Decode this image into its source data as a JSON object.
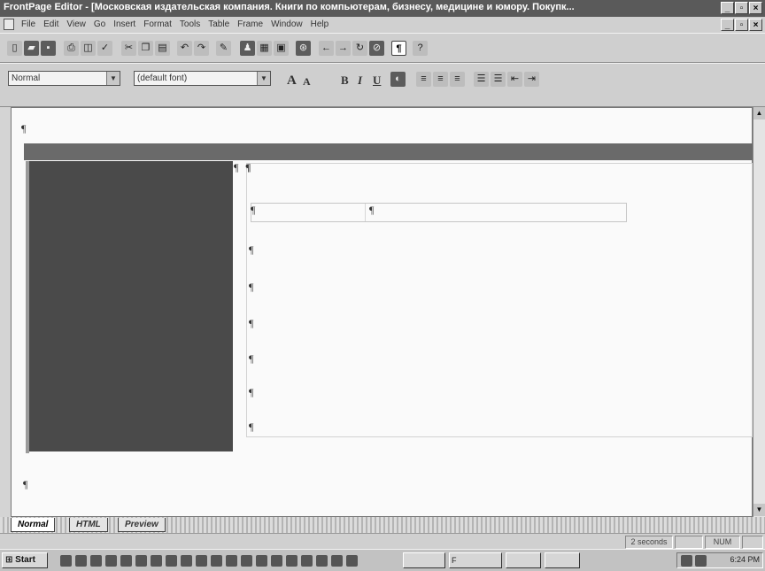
{
  "window": {
    "title": "FrontPage Editor - [Московская издательская компания. Книги по компьютерам, бизнесу, медицине и юмору. Покупк...",
    "minimize": "_",
    "restore": "▫",
    "close": "×"
  },
  "menubar": {
    "items": [
      "File",
      "Edit",
      "View",
      "Go",
      "Insert",
      "Format",
      "Tools",
      "Table",
      "Frame",
      "Window",
      "Help"
    ]
  },
  "format_toolbar": {
    "style_value": "Normal",
    "font_value": "(default font)"
  },
  "editor": {
    "pilcrow": "¶"
  },
  "view_tabs": {
    "items": [
      "Normal",
      "HTML",
      "Preview"
    ],
    "active": "Normal"
  },
  "statusbar": {
    "load_time": "2 seconds",
    "num_indicator": "NUM"
  },
  "taskbar": {
    "start_label": "Start",
    "task_labels": [
      "F",
      "",
      "",
      ""
    ],
    "clock": "6:24 PM"
  },
  "colors": {
    "title_bar": "#5a5a5a",
    "page_banner": "#6a6a6a",
    "page_sidebar": "#4a4a4a",
    "editor_background": "#fafafa"
  }
}
